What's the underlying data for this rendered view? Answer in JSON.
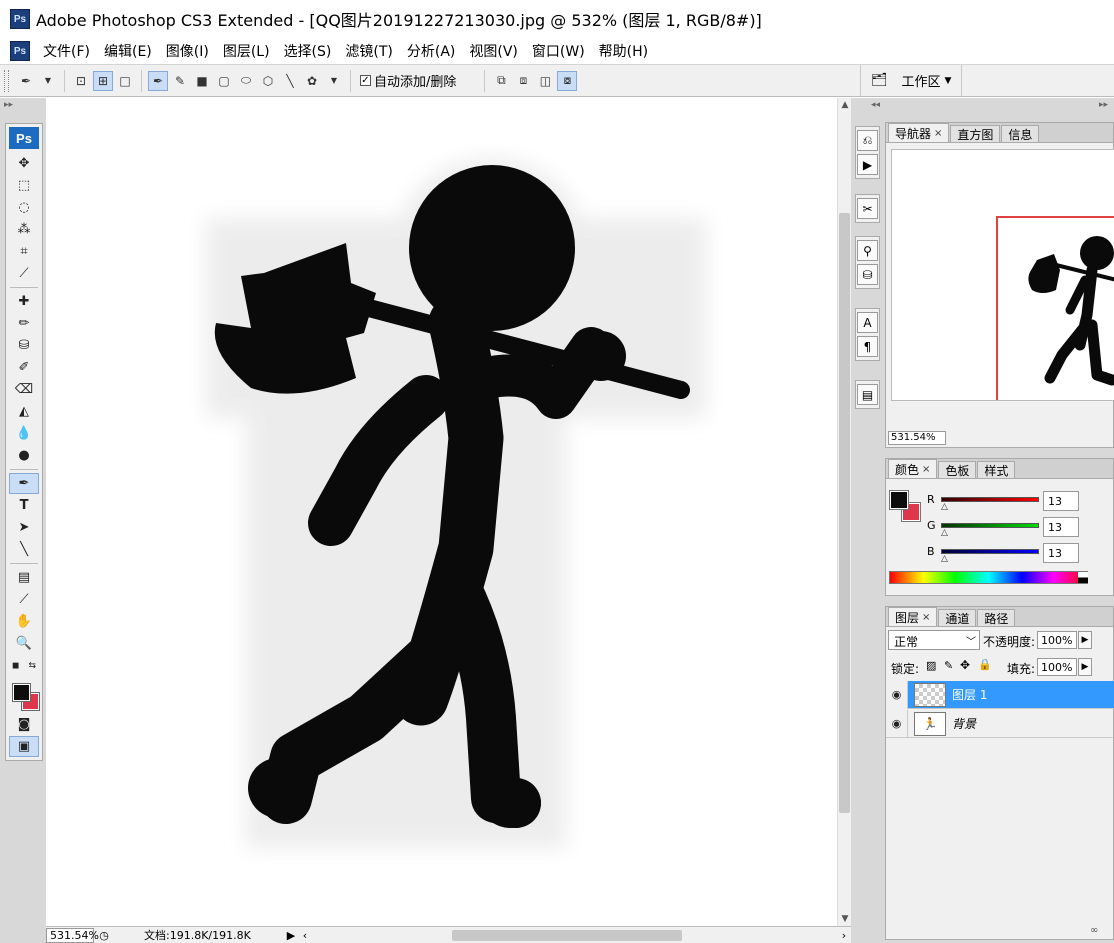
{
  "window": {
    "title": "Adobe Photoshop CS3 Extended - [QQ图片20191227213030.jpg @ 532% (图层 1, RGB/8#)]"
  },
  "menu": [
    "文件(F)",
    "编辑(E)",
    "图像(I)",
    "图层(L)",
    "选择(S)",
    "滤镜(T)",
    "分析(A)",
    "视图(V)",
    "窗口(W)",
    "帮助(H)"
  ],
  "options": {
    "auto_add_delete": "自动添加/删除",
    "workspace": "工作区"
  },
  "navigator_panel": {
    "tabs": [
      "导航器",
      "直方图",
      "信息"
    ],
    "zoom": "531.54%"
  },
  "color_panel": {
    "tabs": [
      "颜色",
      "色板",
      "样式"
    ],
    "channels": [
      {
        "label": "R",
        "value": "13",
        "gradient": "linear-gradient(to right,#000,#f00)"
      },
      {
        "label": "G",
        "value": "13",
        "gradient": "linear-gradient(to right,#000,#0f0)"
      },
      {
        "label": "B",
        "value": "13",
        "gradient": "linear-gradient(to right,#000,#00f)"
      }
    ],
    "foreground": "#0d0d0d",
    "background": "#e0364c"
  },
  "layers_panel": {
    "tabs": [
      "图层",
      "通道",
      "路径"
    ],
    "blend_mode": "正常",
    "opacity_label": "不透明度:",
    "opacity": "100%",
    "lock_label": "锁定:",
    "fill_label": "填充:",
    "fill": "100%",
    "layers": [
      {
        "name": "图层 1",
        "selected": true
      },
      {
        "name": "背景",
        "selected": false
      }
    ]
  },
  "status": {
    "zoom": "531.54%",
    "doc": "文档:191.8K/191.8K"
  }
}
